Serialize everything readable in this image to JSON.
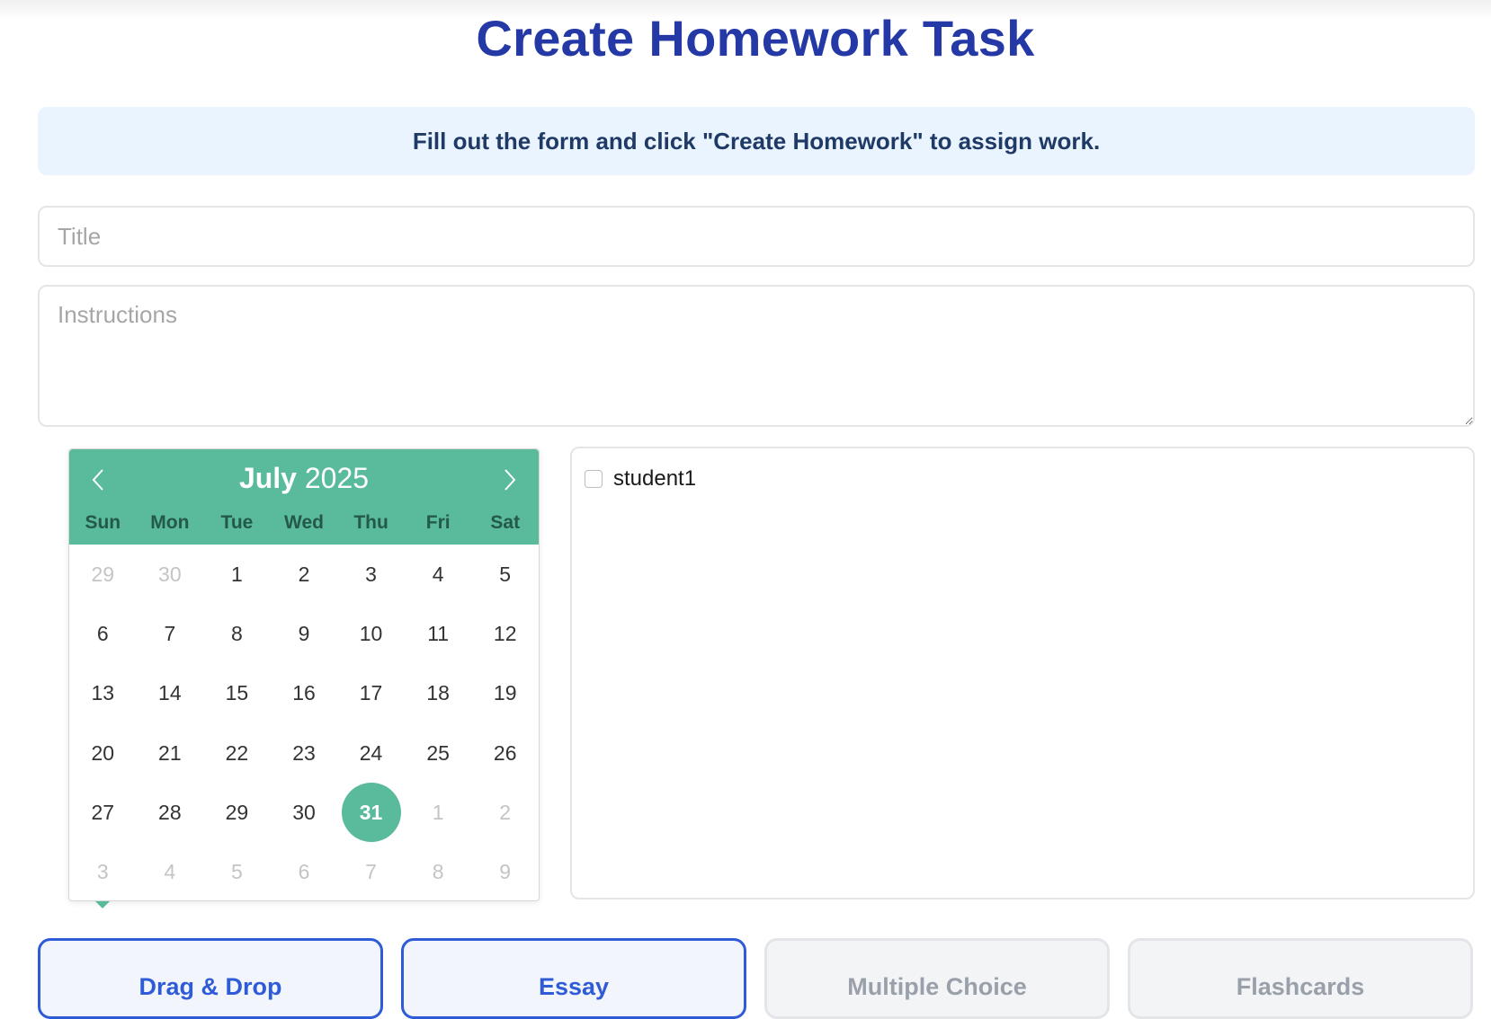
{
  "page": {
    "title": "Create Homework Task",
    "info_banner": "Fill out the form and click \"Create Homework\" to assign work."
  },
  "form": {
    "title_placeholder": "Title",
    "instructions_placeholder": "Instructions"
  },
  "calendar": {
    "month": "July",
    "year": "2025",
    "weekdays": [
      "Sun",
      "Mon",
      "Tue",
      "Wed",
      "Thu",
      "Fri",
      "Sat"
    ],
    "days": [
      {
        "d": "29",
        "muted": true
      },
      {
        "d": "30",
        "muted": true
      },
      {
        "d": "1"
      },
      {
        "d": "2"
      },
      {
        "d": "3"
      },
      {
        "d": "4"
      },
      {
        "d": "5"
      },
      {
        "d": "6"
      },
      {
        "d": "7"
      },
      {
        "d": "8"
      },
      {
        "d": "9"
      },
      {
        "d": "10"
      },
      {
        "d": "11"
      },
      {
        "d": "12"
      },
      {
        "d": "13"
      },
      {
        "d": "14"
      },
      {
        "d": "15"
      },
      {
        "d": "16"
      },
      {
        "d": "17"
      },
      {
        "d": "18"
      },
      {
        "d": "19"
      },
      {
        "d": "20"
      },
      {
        "d": "21"
      },
      {
        "d": "22"
      },
      {
        "d": "23"
      },
      {
        "d": "24"
      },
      {
        "d": "25"
      },
      {
        "d": "26"
      },
      {
        "d": "27"
      },
      {
        "d": "28"
      },
      {
        "d": "29"
      },
      {
        "d": "30"
      },
      {
        "d": "31",
        "selected": true
      },
      {
        "d": "1",
        "muted": true
      },
      {
        "d": "2",
        "muted": true
      },
      {
        "d": "3",
        "muted": true
      },
      {
        "d": "4",
        "muted": true
      },
      {
        "d": "5",
        "muted": true
      },
      {
        "d": "6",
        "muted": true
      },
      {
        "d": "7",
        "muted": true
      },
      {
        "d": "8",
        "muted": true
      },
      {
        "d": "9",
        "muted": true
      }
    ],
    "accent_color": "#59ba9c",
    "prev_icon": "chevron-left-icon",
    "next_icon": "chevron-right-icon"
  },
  "students": [
    {
      "name": "student1",
      "checked": false
    }
  ],
  "homework_types": [
    {
      "label": "Drag & Drop",
      "state": "active"
    },
    {
      "label": "Essay",
      "state": "active"
    },
    {
      "label": "Multiple Choice",
      "state": "inactive"
    },
    {
      "label": "Flashcards",
      "state": "inactive"
    }
  ],
  "colors": {
    "title": "#2438a6",
    "banner_bg": "#eaf4fe",
    "active_type": "#2f5cd6"
  }
}
